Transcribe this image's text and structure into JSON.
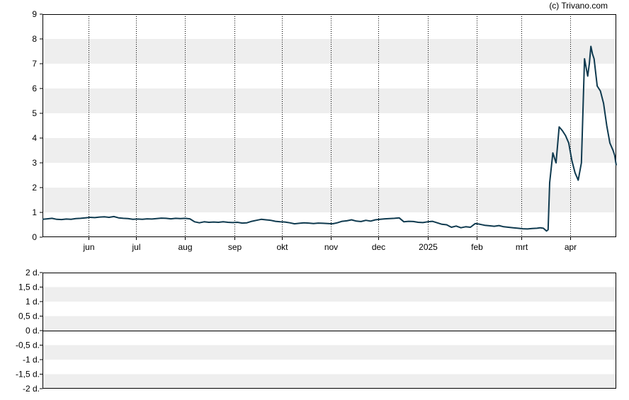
{
  "copyright": "(c) Trivano.com",
  "colors": {
    "line": "#0f3a4f",
    "band": "#eeeeee",
    "axis": "#000000",
    "grid": "#000000"
  },
  "chart_data": [
    {
      "type": "line",
      "title": "",
      "xlabel": "",
      "ylabel": "",
      "ylim": [
        0,
        9
      ],
      "yticks": [
        "0",
        "1",
        "2",
        "3",
        "4",
        "5",
        "6",
        "7",
        "8",
        "9"
      ],
      "xticks": [
        {
          "label": "jun",
          "x": "2024-06-01"
        },
        {
          "label": "jul",
          "x": "2024-07-01"
        },
        {
          "label": "aug",
          "x": "2024-08-01"
        },
        {
          "label": "sep",
          "x": "2024-09-01"
        },
        {
          "label": "okt",
          "x": "2024-10-01"
        },
        {
          "label": "nov",
          "x": "2024-11-01"
        },
        {
          "label": "dec",
          "x": "2024-12-01"
        },
        {
          "label": "2025",
          "x": "2025-01-01"
        },
        {
          "label": "feb",
          "x": "2025-02-01"
        },
        {
          "label": "mrt",
          "x": "2025-03-01"
        },
        {
          "label": "apr",
          "x": "2025-04-01"
        }
      ],
      "xlim": [
        "2024-05-03",
        "2025-04-30"
      ],
      "grid": true,
      "series": [
        {
          "x": [
            "2024-05-03",
            "2024-05-06",
            "2024-05-09",
            "2024-05-12",
            "2024-05-15",
            "2024-05-18",
            "2024-05-21",
            "2024-05-24",
            "2024-05-27",
            "2024-05-30",
            "2024-06-02",
            "2024-06-05",
            "2024-06-08",
            "2024-06-11",
            "2024-06-14",
            "2024-06-17",
            "2024-06-20",
            "2024-06-23",
            "2024-06-26",
            "2024-06-29",
            "2024-07-02",
            "2024-07-05",
            "2024-07-08",
            "2024-07-11",
            "2024-07-14",
            "2024-07-17",
            "2024-07-20",
            "2024-07-23",
            "2024-07-26",
            "2024-07-29",
            "2024-08-01",
            "2024-08-04",
            "2024-08-07",
            "2024-08-10",
            "2024-08-13",
            "2024-08-16",
            "2024-08-19",
            "2024-08-22",
            "2024-08-25",
            "2024-08-28",
            "2024-08-31",
            "2024-09-03",
            "2024-09-06",
            "2024-09-09",
            "2024-09-12",
            "2024-09-15",
            "2024-09-18",
            "2024-09-21",
            "2024-09-24",
            "2024-09-27",
            "2024-09-30",
            "2024-10-03",
            "2024-10-06",
            "2024-10-09",
            "2024-10-12",
            "2024-10-15",
            "2024-10-18",
            "2024-10-21",
            "2024-10-24",
            "2024-10-27",
            "2024-10-30",
            "2024-11-02",
            "2024-11-05",
            "2024-11-08",
            "2024-11-11",
            "2024-11-14",
            "2024-11-17",
            "2024-11-20",
            "2024-11-23",
            "2024-11-26",
            "2024-11-29",
            "2024-12-02",
            "2024-12-05",
            "2024-12-08",
            "2024-12-11",
            "2024-12-14",
            "2024-12-17",
            "2024-12-20",
            "2024-12-23",
            "2024-12-26",
            "2024-12-29",
            "2025-01-01",
            "2025-01-04",
            "2025-01-07",
            "2025-01-10",
            "2025-01-13",
            "2025-01-16",
            "2025-01-19",
            "2025-01-22",
            "2025-01-25",
            "2025-01-28",
            "2025-01-31",
            "2025-02-03",
            "2025-02-06",
            "2025-02-09",
            "2025-02-12",
            "2025-02-15",
            "2025-02-18",
            "2025-02-21",
            "2025-02-24",
            "2025-02-27",
            "2025-03-02",
            "2025-03-05",
            "2025-03-08",
            "2025-03-11",
            "2025-03-13",
            "2025-03-15",
            "2025-03-17",
            "2025-03-18",
            "2025-03-19",
            "2025-03-21",
            "2025-03-23",
            "2025-03-25",
            "2025-03-27",
            "2025-03-29",
            "2025-03-31",
            "2025-04-02",
            "2025-04-04",
            "2025-04-06",
            "2025-04-08",
            "2025-04-10",
            "2025-04-12",
            "2025-04-13",
            "2025-04-14",
            "2025-04-15",
            "2025-04-16",
            "2025-04-18",
            "2025-04-20",
            "2025-04-22",
            "2025-04-24",
            "2025-04-26",
            "2025-04-28",
            "2025-04-29",
            "2025-04-30"
          ],
          "y": [
            0.72,
            0.74,
            0.76,
            0.72,
            0.71,
            0.73,
            0.72,
            0.75,
            0.76,
            0.78,
            0.8,
            0.79,
            0.81,
            0.82,
            0.8,
            0.83,
            0.78,
            0.76,
            0.75,
            0.72,
            0.73,
            0.72,
            0.74,
            0.73,
            0.75,
            0.77,
            0.76,
            0.74,
            0.76,
            0.75,
            0.76,
            0.74,
            0.62,
            0.58,
            0.62,
            0.6,
            0.61,
            0.6,
            0.62,
            0.6,
            0.59,
            0.6,
            0.57,
            0.58,
            0.64,
            0.68,
            0.72,
            0.7,
            0.68,
            0.64,
            0.62,
            0.61,
            0.58,
            0.54,
            0.56,
            0.58,
            0.57,
            0.55,
            0.57,
            0.56,
            0.55,
            0.54,
            0.58,
            0.64,
            0.66,
            0.7,
            0.65,
            0.63,
            0.68,
            0.65,
            0.7,
            0.72,
            0.74,
            0.75,
            0.76,
            0.78,
            0.62,
            0.64,
            0.63,
            0.6,
            0.59,
            0.62,
            0.64,
            0.58,
            0.52,
            0.5,
            0.4,
            0.45,
            0.38,
            0.42,
            0.4,
            0.55,
            0.52,
            0.48,
            0.46,
            0.44,
            0.47,
            0.42,
            0.4,
            0.38,
            0.36,
            0.34,
            0.33,
            0.35,
            0.36,
            0.38,
            0.36,
            0.25,
            0.3,
            2.2,
            3.4,
            3.0,
            4.45,
            4.3,
            4.1,
            3.8,
            3.1,
            2.6,
            2.3,
            3.0,
            7.2,
            6.5,
            7.0,
            7.7,
            7.4,
            7.2,
            6.1,
            5.9,
            5.4,
            4.5,
            3.8,
            3.5,
            3.3,
            2.9
          ]
        }
      ]
    },
    {
      "type": "line",
      "title": "",
      "xlabel": "",
      "ylabel": "",
      "ylim": [
        -2,
        2
      ],
      "yticks": [
        "-2 d.",
        "-1,5 d.",
        "-1 d.",
        "-0,5 d.",
        "0 d.",
        "0,5 d.",
        "1 d.",
        "1,5 d.",
        "2 d."
      ],
      "grid": true,
      "series": []
    }
  ]
}
